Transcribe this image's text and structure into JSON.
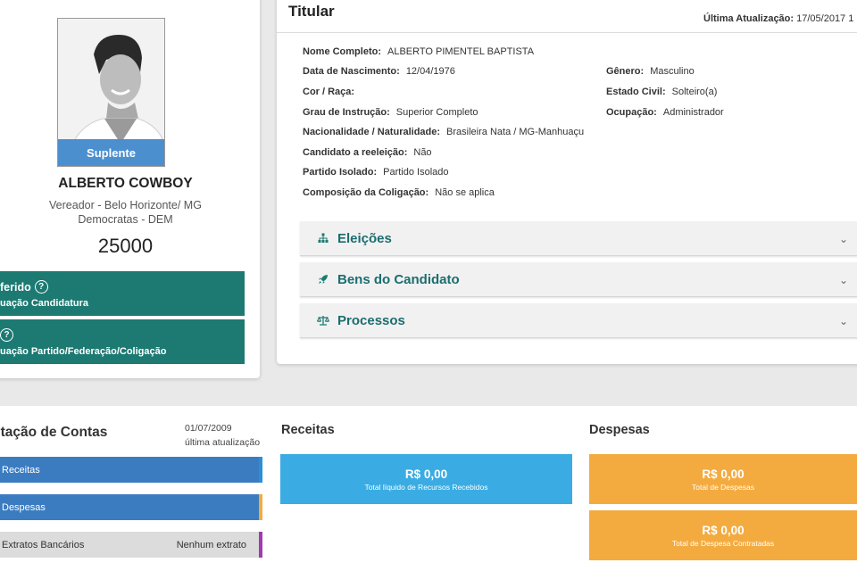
{
  "candidate": {
    "status_label": "Suplente",
    "name": "ALBERTO COWBOY",
    "office": "Vereador - Belo Horizonte/ MG",
    "party": "Democratas - DEM",
    "number": "25000",
    "box1_title": "ferido",
    "box1_sub": "uação Candidatura",
    "box2_sub": "uação Partido/Federação/Coligação"
  },
  "titular": {
    "title": "Titular",
    "update_label": "Última Atualização:",
    "update_value": "17/05/2017 1",
    "fields_left": [
      {
        "k": "Nome Completo:",
        "v": "ALBERTO PIMENTEL BAPTISTA"
      },
      {
        "k": "Data de Nascimento:",
        "v": "12/04/1976"
      },
      {
        "k": "Cor / Raça:",
        "v": ""
      },
      {
        "k": "Grau de Instrução:",
        "v": "Superior Completo"
      },
      {
        "k": "Nacionalidade / Naturalidade:",
        "v": "Brasileira Nata / MG-Manhuaçu"
      },
      {
        "k": "Candidato a reeleição:",
        "v": "Não"
      },
      {
        "k": "Partido Isolado:",
        "v": "Partido Isolado"
      },
      {
        "k": "Composição da Coligação:",
        "v": "Não se aplica"
      }
    ],
    "fields_right": [
      {
        "k": "Gênero:",
        "v": "Masculino"
      },
      {
        "k": "Estado Civil:",
        "v": "Solteiro(a)"
      },
      {
        "k": "Ocupação:",
        "v": "Administrador"
      }
    ],
    "accordions": [
      {
        "label": "Eleições",
        "icon": "sitemap-icon"
      },
      {
        "label": "Bens do Candidato",
        "icon": "rocket-icon"
      },
      {
        "label": "Processos",
        "icon": "balance-scale-icon"
      }
    ]
  },
  "contas": {
    "title": "stação de Contas",
    "date": "01/07/2009",
    "date_label": "última atualização",
    "items": [
      {
        "label": "Receitas",
        "right": ""
      },
      {
        "label": "Despesas",
        "right": ""
      },
      {
        "label": "Extratos Bancários",
        "right": "Nenhum extrato"
      }
    ]
  },
  "receitas": {
    "title": "Receitas",
    "amount": "R$ 0,00",
    "caption": "Total líquido de Recursos Recebidos"
  },
  "despesas": {
    "title": "Despesas",
    "items": [
      {
        "amount": "R$ 0,00",
        "caption": "Total de Despesas"
      },
      {
        "amount": "R$ 0,00",
        "caption": "Total de Despesa Contratadas"
      }
    ]
  },
  "colors": {
    "teal": "#1c7a72",
    "blue": "#3b7cc1",
    "light_blue": "#3aace3",
    "orange": "#f3ab40",
    "grey": "#d9d9d9"
  }
}
